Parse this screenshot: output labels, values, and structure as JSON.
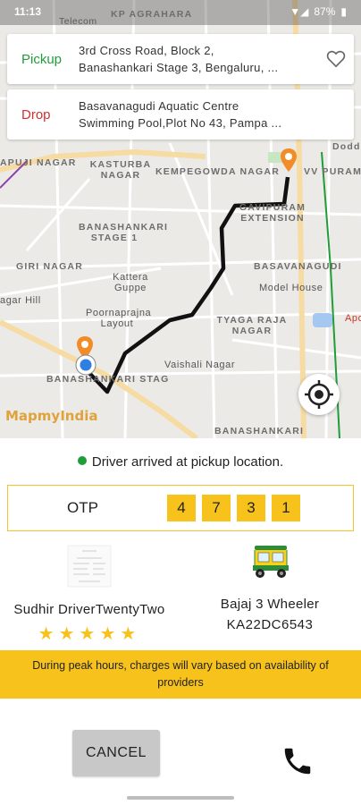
{
  "status_bar": {
    "time": "11:13",
    "battery": "87%"
  },
  "map": {
    "labels": [
      "Telecom",
      "KP AGRAHARA",
      "APUJI NAGAR",
      "KASTURBA NAGAR",
      "KEMPEGOWDA NAGAR",
      "VV PURAM",
      "Dodd",
      "GAVIPURAM EXTENSION",
      "BANASHANKARI STAGE 1",
      "BASAVANAGUDI",
      "GIRI NAGAR",
      "Kattera Guppe",
      "Model House",
      "Poornaprajna Layout",
      "TYAGA RAJA NAGAR",
      "Apo",
      "Vaishali Nagar",
      "BANASHANKARI STAG",
      "BANASHANKARI",
      "agar Hill"
    ],
    "brand": "MapmyIndia"
  },
  "pickup": {
    "label": "Pickup",
    "line1": "3rd Cross Road, Block 2,",
    "line2": "Banashankari Stage 3, Bengaluru, ..."
  },
  "drop": {
    "label": "Drop",
    "line1": "Basavanagudi Aquatic Centre",
    "line2": "Swimming Pool,Plot No 43, Pampa ..."
  },
  "status_message": "Driver arrived at pickup location.",
  "otp": {
    "label": "OTP",
    "digits": [
      "4",
      "7",
      "3",
      "1"
    ]
  },
  "driver": {
    "name": "Sudhir DriverTwentyTwo",
    "rating": 5
  },
  "vehicle": {
    "type": "Bajaj 3 Wheeler",
    "plate": "KA22DC6543"
  },
  "notice": "During peak hours, charges will vary based on availability of providers",
  "actions": {
    "cancel_label": "CANCEL"
  },
  "colors": {
    "accent": "#f6c21b",
    "pickup": "#1f9d3a",
    "drop": "#d32f2f",
    "route": "#111111"
  },
  "icons": {
    "favorite": "heart-icon",
    "locate": "crosshair-icon",
    "call": "phone-icon"
  }
}
